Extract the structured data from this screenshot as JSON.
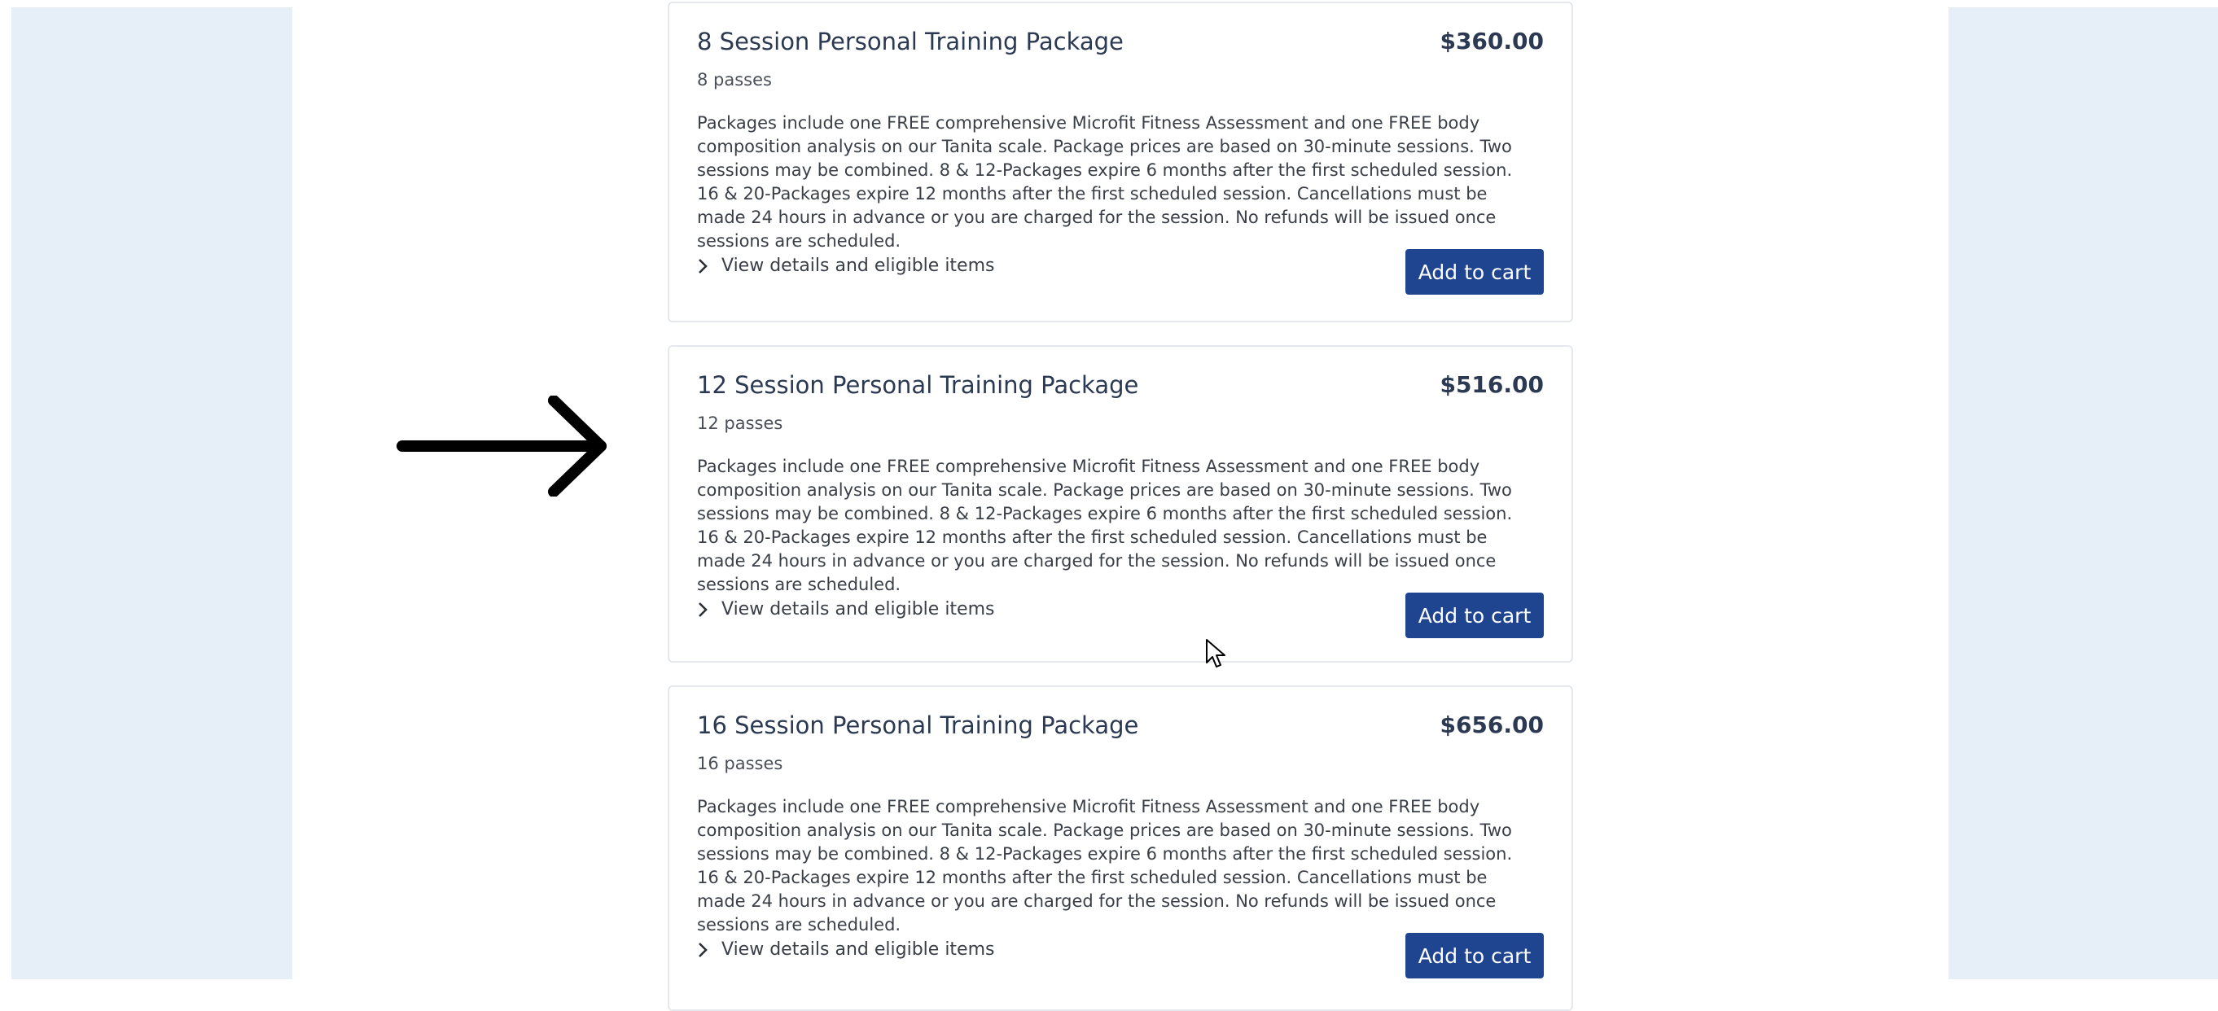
{
  "colors": {
    "side_panel": "#e6eff8",
    "primary_button": "#1f4590",
    "card_border": "#e5e8ec",
    "title_text": "#2b3a52"
  },
  "packages": [
    {
      "title": "8 Session Personal Training Package",
      "price": "$360.00",
      "passes": "8 passes",
      "description": "Packages include one FREE comprehensive Microfit Fitness Assessment and one FREE body composition analysis on our Tanita scale. Package prices are based on 30-minute sessions. Two sessions may be combined. 8 & 12-Packages expire 6 months after the first scheduled session. 16 & 20-Packages expire 12 months after the first scheduled session. Cancellations must be made 24 hours in advance or you are charged for the session. No refunds will be issued once sessions are scheduled.",
      "details_label": "View details and eligible items",
      "button_label": "Add to cart"
    },
    {
      "title": "12 Session Personal Training Package",
      "price": "$516.00",
      "passes": "12 passes",
      "description": "Packages include one FREE comprehensive Microfit Fitness Assessment and one FREE body composition analysis on our Tanita scale. Package prices are based on 30-minute sessions. Two sessions may be combined. 8 & 12-Packages expire 6 months after the first scheduled session. 16 & 20-Packages expire 12 months after the first scheduled session. Cancellations must be made 24 hours in advance or you are charged for the session. No refunds will be issued once sessions are scheduled.",
      "details_label": "View details and eligible items",
      "button_label": "Add to cart"
    },
    {
      "title": "16 Session Personal Training Package",
      "price": "$656.00",
      "passes": "16 passes",
      "description": "Packages include one FREE comprehensive Microfit Fitness Assessment and one FREE body composition analysis on our Tanita scale. Package prices are based on 30-minute sessions. Two sessions may be combined. 8 & 12-Packages expire 6 months after the first scheduled session. 16 & 20-Packages expire 12 months after the first scheduled session. Cancellations must be made 24 hours in advance or you are charged for the session. No refunds will be issued once sessions are scheduled.",
      "details_label": "View details and eligible items",
      "button_label": "Add to cart"
    }
  ],
  "icons": {
    "annotation": "arrow-right-icon",
    "chevron": "chevron-right-icon",
    "cursor": "mouse-cursor-icon"
  }
}
